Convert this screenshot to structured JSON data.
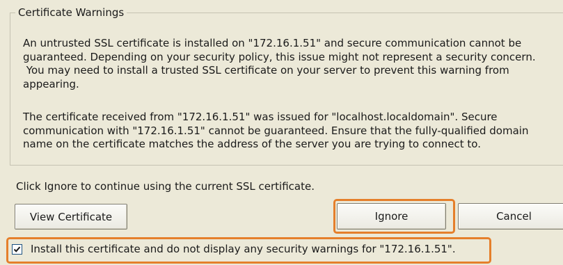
{
  "group": {
    "legend": "Certificate Warnings",
    "paragraph1": [
      "An untrusted SSL certificate is installed on \"172.16.1.51\" and secure communication cannot be",
      "guaranteed.  Depending on your security policy, this issue might not represent a security concern.",
      " You may need to install a trusted SSL certificate on your server to prevent this warning from",
      "appearing."
    ],
    "paragraph2": [
      "The certificate received from \"172.16.1.51\" was issued for \"localhost.localdomain\".  Secure",
      "communication with \"172.16.1.51\" cannot be guaranteed.  Ensure that the fully-qualified domain",
      "name on the certificate matches the address of the server you are trying to connect to."
    ]
  },
  "hint": "Click Ignore to continue using the current SSL certificate.",
  "buttons": {
    "view_certificate": "View Certificate",
    "ignore": "Ignore",
    "cancel": "Cancel"
  },
  "checkbox": {
    "checked": true,
    "label": "Install this certificate and do not display any security warnings for \"172.16.1.51\"."
  },
  "colors": {
    "background": "#ece9d8",
    "highlight": "#e57f2b",
    "checkbox_border": "#1c5180"
  },
  "icons": {
    "checkbox": "checkmark-icon"
  }
}
